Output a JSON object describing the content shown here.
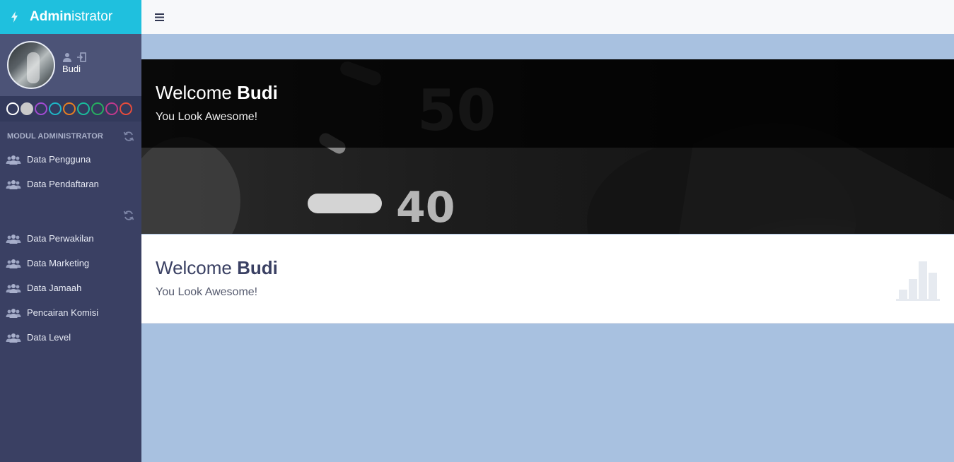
{
  "brand": {
    "title_bold": "Admin",
    "title_light": "istrator"
  },
  "profile": {
    "name": "Budi"
  },
  "theme_swatches": [
    "#ffffff",
    "#c9c9c9",
    "#a24bd2",
    "#1fb6c6",
    "#e67e22",
    "#1abc9c",
    "#27ae60",
    "#c0398d",
    "#e74c3c"
  ],
  "sidebar": {
    "section_title": "MODUL ADMINISTRATOR",
    "group1": [
      {
        "label": "Data Pengguna"
      },
      {
        "label": "Data Pendaftaran"
      }
    ],
    "group2": [
      {
        "label": "Data Perwakilan"
      },
      {
        "label": "Data Marketing"
      },
      {
        "label": "Data Jamaah"
      },
      {
        "label": "Pencairan Komisi"
      },
      {
        "label": "Data Level"
      }
    ]
  },
  "hero": {
    "welcome": "Welcome",
    "name": "Budi",
    "subtitle": "You Look Awesome!"
  },
  "card": {
    "welcome": "Welcome",
    "name": "Budi",
    "subtitle": "You Look Awesome!"
  }
}
